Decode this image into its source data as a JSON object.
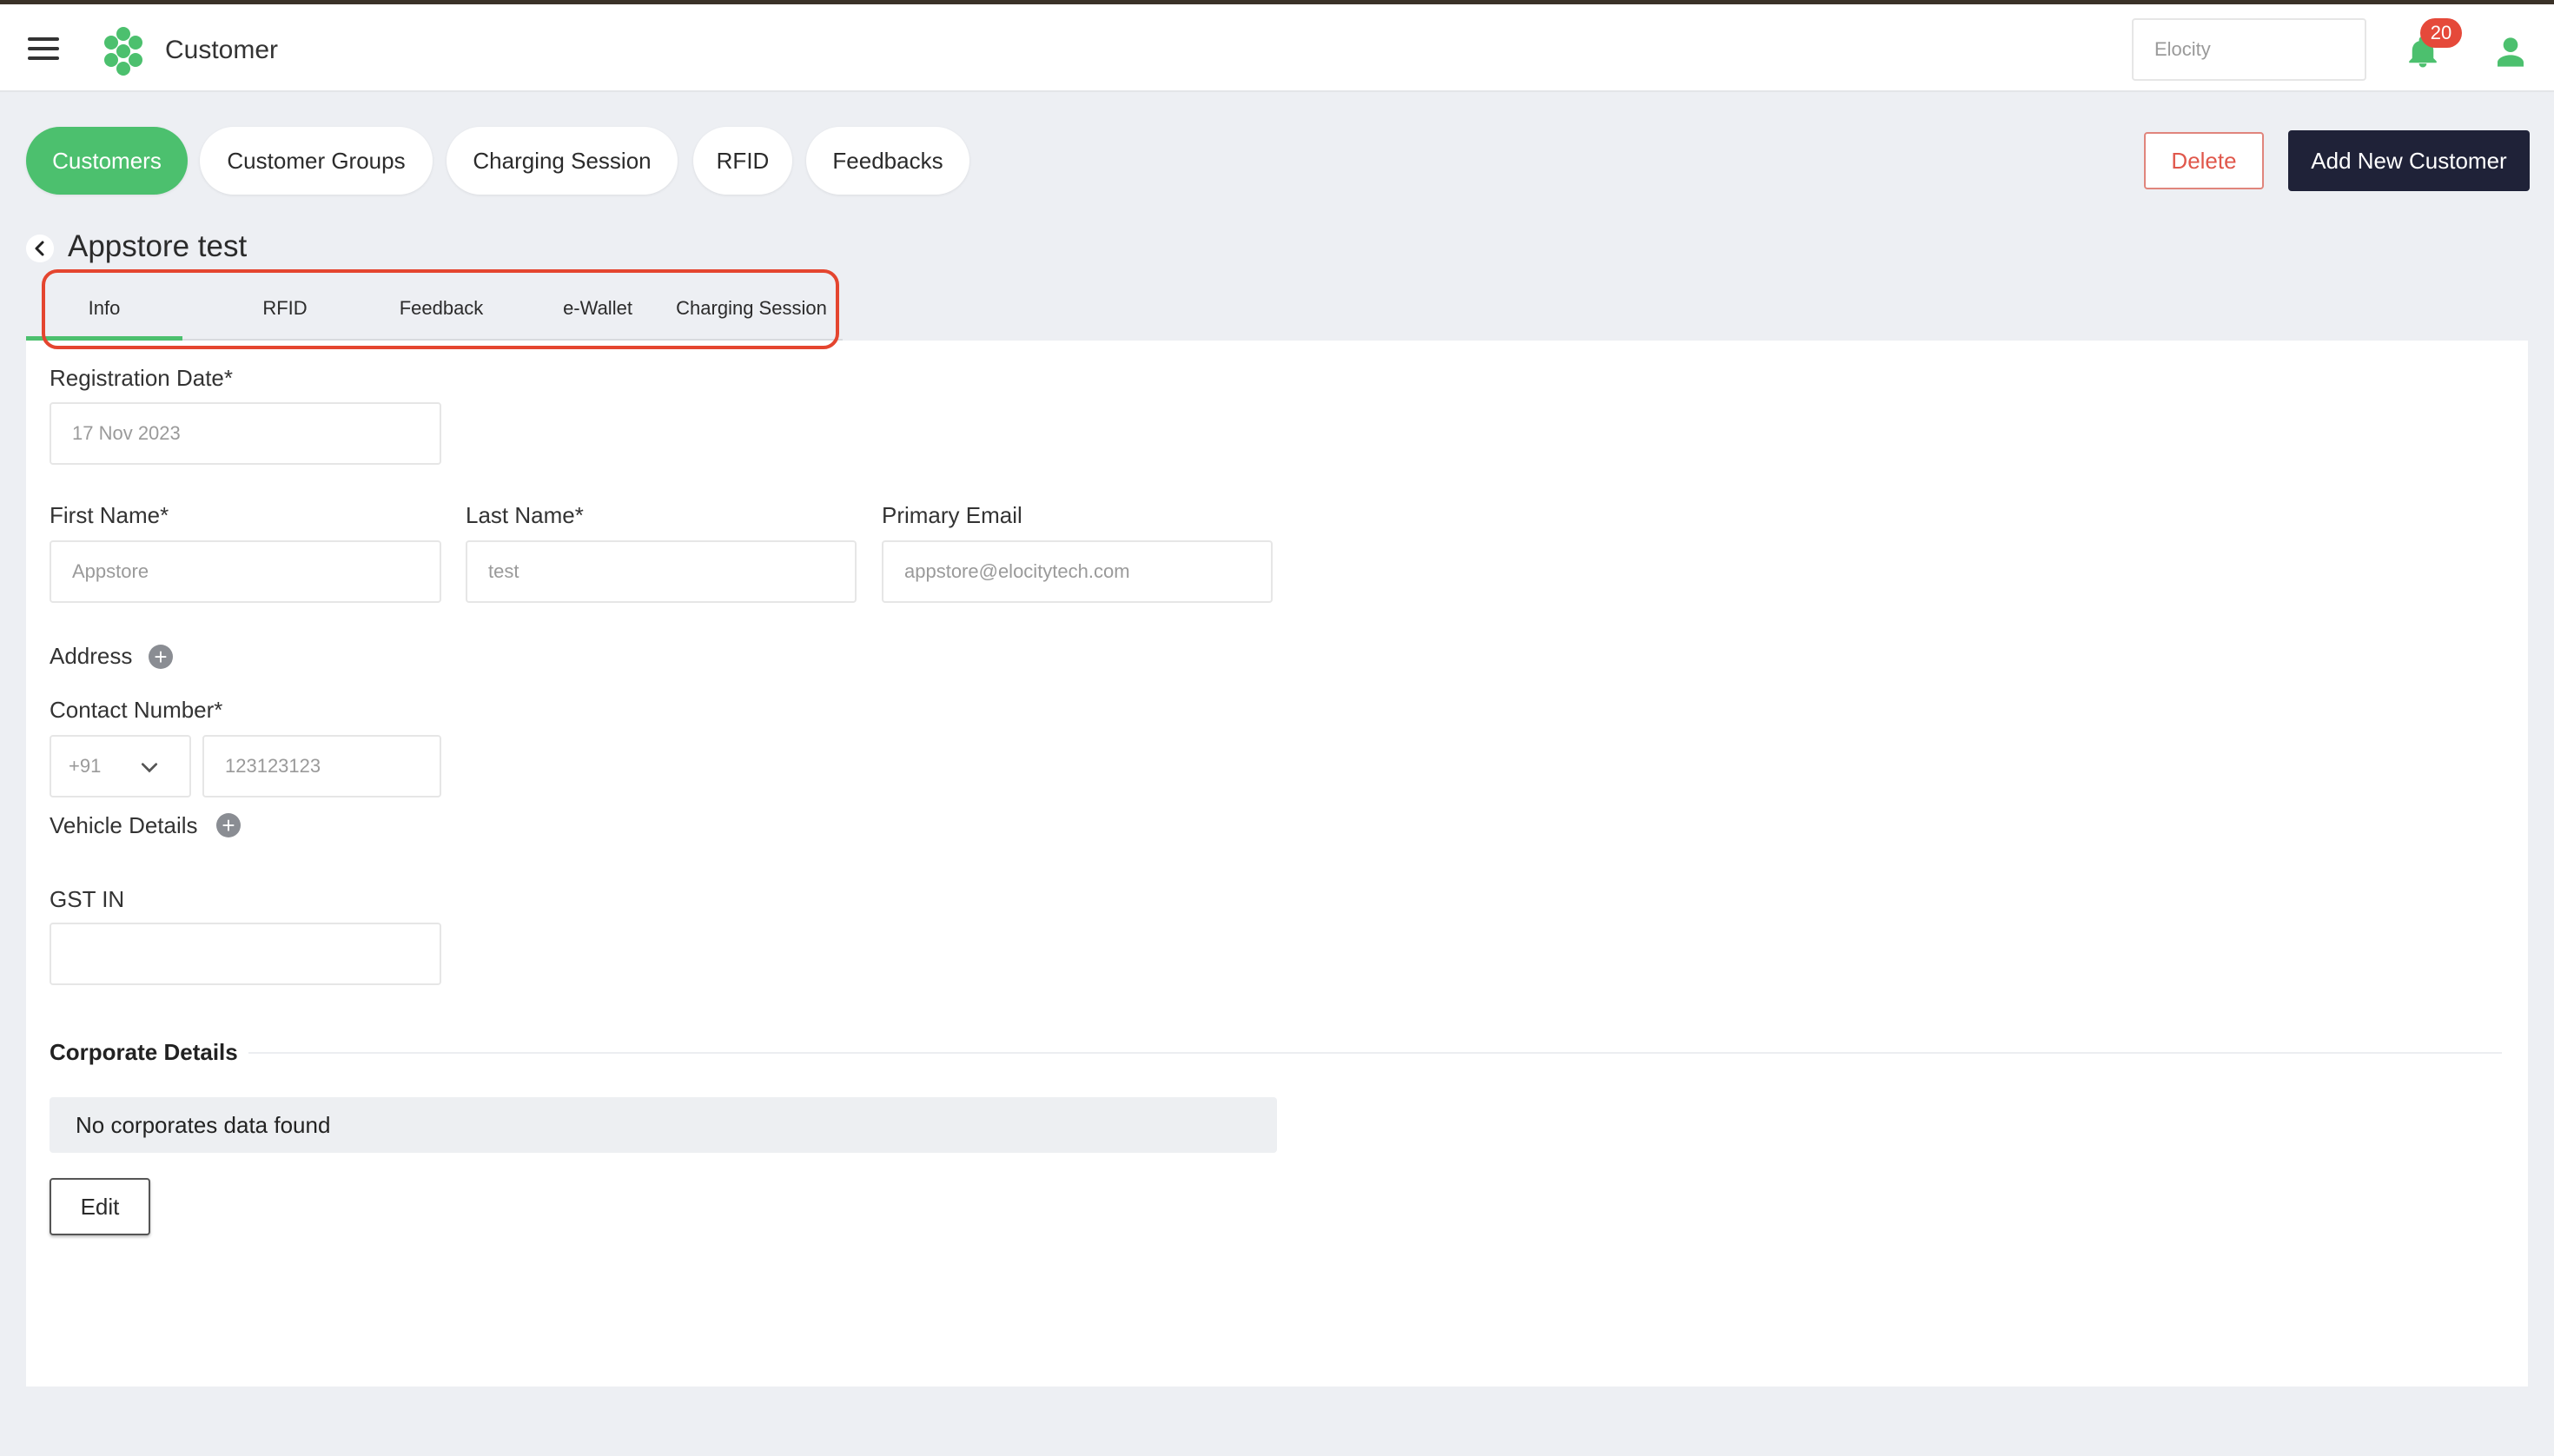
{
  "app": {
    "title": "Customer",
    "org_search": {
      "value": "Elocity"
    },
    "notification_count": "20",
    "colors": {
      "accent": "#4cc06e",
      "primary_dark": "#1f2238",
      "danger": "#e0574b",
      "badge": "#e5493a"
    }
  },
  "nav": {
    "pills": [
      {
        "label": "Customers",
        "active": true
      },
      {
        "label": "Customer Groups",
        "active": false
      },
      {
        "label": "Charging Session",
        "active": false
      },
      {
        "label": "RFID",
        "active": false
      },
      {
        "label": "Feedbacks",
        "active": false
      }
    ]
  },
  "actions": {
    "delete_label": "Delete",
    "add_label": "Add New Customer"
  },
  "customer": {
    "name": "Appstore test"
  },
  "tabs": [
    {
      "label": "Info",
      "active": true
    },
    {
      "label": "RFID",
      "active": false
    },
    {
      "label": "Feedback",
      "active": false
    },
    {
      "label": "e-Wallet",
      "active": false
    },
    {
      "label": "Charging Session",
      "active": false
    }
  ],
  "form": {
    "registration_date": {
      "label": "Registration Date*",
      "value": "17 Nov 2023"
    },
    "first_name": {
      "label": "First Name*",
      "value": "Appstore"
    },
    "last_name": {
      "label": "Last Name*",
      "value": "test"
    },
    "primary_email": {
      "label": "Primary Email",
      "value": "appstore@elocitytech.com"
    },
    "address": {
      "label": "Address"
    },
    "contact_number": {
      "label": "Contact Number*",
      "country_code": "+91",
      "value": "123123123"
    },
    "vehicle_details": {
      "label": "Vehicle Details"
    },
    "gst_in": {
      "label": "GST IN",
      "value": ""
    }
  },
  "corporate": {
    "title": "Corporate Details",
    "empty_text": "No corporates data found",
    "edit_label": "Edit"
  }
}
